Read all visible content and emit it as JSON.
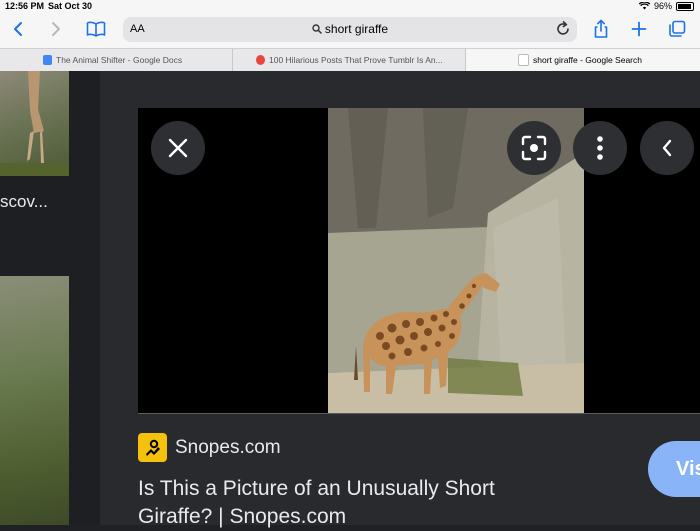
{
  "status_bar": {
    "time": "12:56 PM",
    "date": "Sat Oct 30",
    "battery": "96%"
  },
  "toolbar": {
    "aa_label": "AA",
    "url": "short giraffe",
    "icons": [
      "back-icon",
      "forward-icon",
      "bookmarks-icon",
      "search-icon",
      "reload-icon",
      "share-icon",
      "new-tab-icon",
      "tabs-overview-icon"
    ]
  },
  "tabs": [
    {
      "label": "The Animal Shifter - Google Docs",
      "favicon_color": "#4285f4"
    },
    {
      "label": "100 Hilarious Posts That Prove Tumblr Is An...",
      "favicon_color": "#e8453c"
    },
    {
      "label": "short giraffe - Google Search",
      "favicon_color": "#9aa0a6"
    }
  ],
  "left_column": {
    "partial_text": "scov..."
  },
  "viewer": {
    "buttons": [
      "close-icon",
      "lens-icon",
      "more-icon",
      "back-arrow-icon"
    ],
    "source_name": "Snopes.com",
    "title": "Is This a Picture of an Unusually Short Giraffe? | Snopes.com",
    "visit_label": "Vis"
  },
  "colors": {
    "accent": "#8ab4f8",
    "panel_bg": "#292a2d",
    "snopes_yellow": "#f4c20d"
  }
}
